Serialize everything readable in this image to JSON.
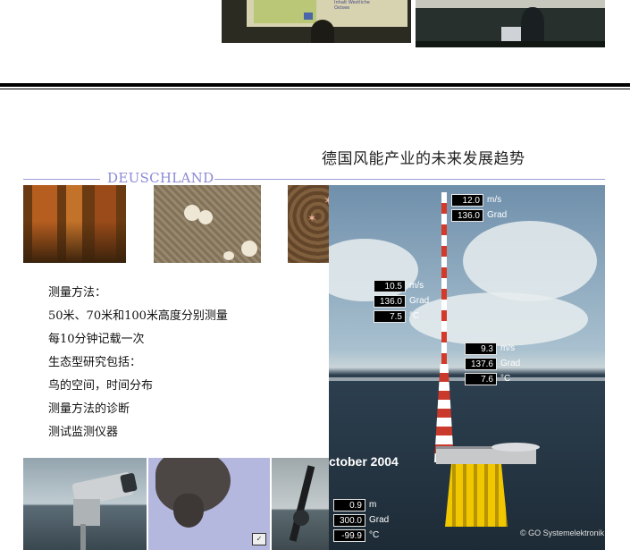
{
  "slide": {
    "title": "德国风能产业的未来发展趋势",
    "region": "DEUSCHLAND"
  },
  "text_lines": [
    "测量方法：",
    "50米、70米和100米高度分别测量",
    "每10分钟记载一次",
    "生态型研究包括：",
    "鸟的空间，时间分布",
    "测量方法的诊断",
    "测试监测仪器"
  ],
  "readouts": {
    "top": {
      "speed": "12.0",
      "speed_unit": "m/s",
      "direction": "136.0",
      "direction_unit": "Grad"
    },
    "mid": {
      "speed": "10.5",
      "speed_unit": "m/s",
      "direction": "136.0",
      "direction_unit": "Grad",
      "temp": "7.5",
      "temp_unit": "°C"
    },
    "low": {
      "speed": "9.3",
      "speed_unit": "m/s",
      "direction": "137.6",
      "direction_unit": "Grad",
      "temp": "7.6",
      "temp_unit": "°C"
    },
    "sea": {
      "level": "0.9",
      "level_unit": "m",
      "direction": "300.0",
      "direction_unit": "Grad",
      "temp": "-99.9",
      "temp_unit": "°C"
    }
  },
  "photo": {
    "date": "ctober 2004",
    "credit": "© GO Systemelektronik"
  },
  "top_slide_text": "Inhalt\nWestliche Ostsee"
}
